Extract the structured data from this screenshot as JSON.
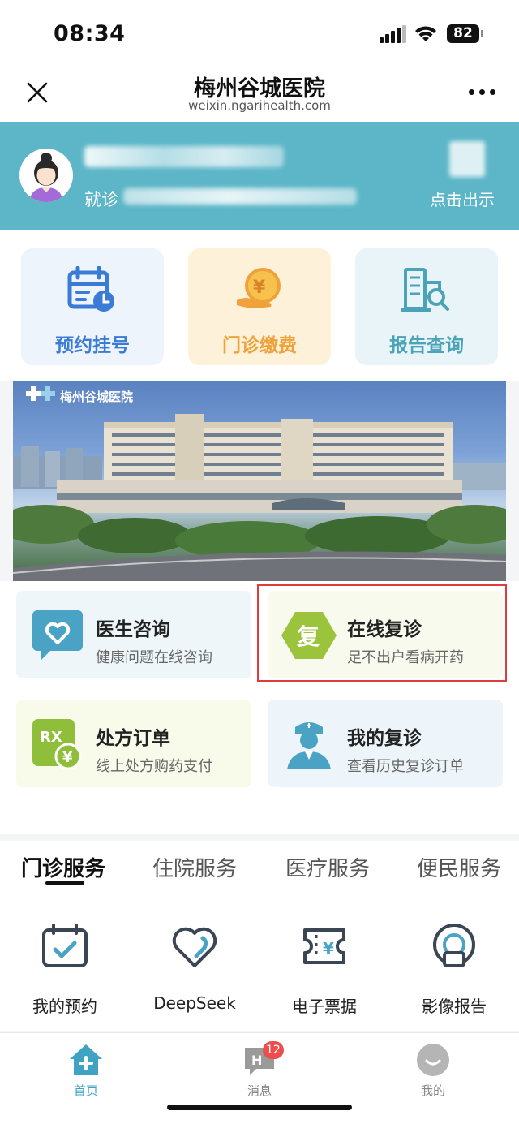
{
  "status_bar": {
    "time": "08:34",
    "battery": "82"
  },
  "nav": {
    "title": "梅州谷城医院",
    "url": "weixin.ngarihealth.com"
  },
  "patient": {
    "visit_label": "就诊",
    "show_code_label": "点击出示"
  },
  "quick_tiles": [
    {
      "label": "预约挂号",
      "icon": "calendar-clock-icon",
      "bg": "#eef4fc",
      "color": "#3a7bd5"
    },
    {
      "label": "门诊缴费",
      "icon": "yuan-coin-hand-icon",
      "bg": "#fdf1d9",
      "color": "#f0a23a"
    },
    {
      "label": "报告查询",
      "icon": "building-search-icon",
      "bg": "#e8f4f8",
      "color": "#4aa3b8"
    }
  ],
  "banner": {
    "logo_text": "梅州谷城医院"
  },
  "service_cards": [
    {
      "title": "医生咨询",
      "subtitle": "健康问题在线咨询",
      "icon": "heart-chat-icon",
      "bg": "#eef6fa"
    },
    {
      "title": "在线复诊",
      "subtitle": "足不出户看病开药",
      "icon": "hexagon-fu-icon",
      "icon_text": "复",
      "bg": "#f8faee"
    },
    {
      "title": "处方订单",
      "subtitle": "线上处方购药支付",
      "icon": "rx-yuan-icon",
      "icon_text": "RX",
      "bg": "#f8fbe9"
    },
    {
      "title": "我的复诊",
      "subtitle": "查看历史复诊订单",
      "icon": "doctor-icon",
      "bg": "#eef5fa"
    }
  ],
  "tabs": [
    {
      "label": "门诊服务",
      "active": true
    },
    {
      "label": "住院服务",
      "active": false
    },
    {
      "label": "医疗服务",
      "active": false
    },
    {
      "label": "便民服务",
      "active": false
    }
  ],
  "services": [
    {
      "label": "我的预约",
      "icon": "calendar-check-icon"
    },
    {
      "label": "DeepSeek",
      "icon": "heart-outline-icon"
    },
    {
      "label": "电子票据",
      "icon": "ticket-yuan-icon"
    },
    {
      "label": "影像报告",
      "icon": "scanner-icon"
    }
  ],
  "tabbar": [
    {
      "label": "首页",
      "icon": "home-icon",
      "active": true
    },
    {
      "label": "消息",
      "icon": "message-icon",
      "badge": "12"
    },
    {
      "label": "我的",
      "icon": "profile-icon"
    }
  ],
  "colors": {
    "header_teal": "#5db6c8",
    "active_tab": "#3fa3c4",
    "highlight": "#e23b3b"
  }
}
